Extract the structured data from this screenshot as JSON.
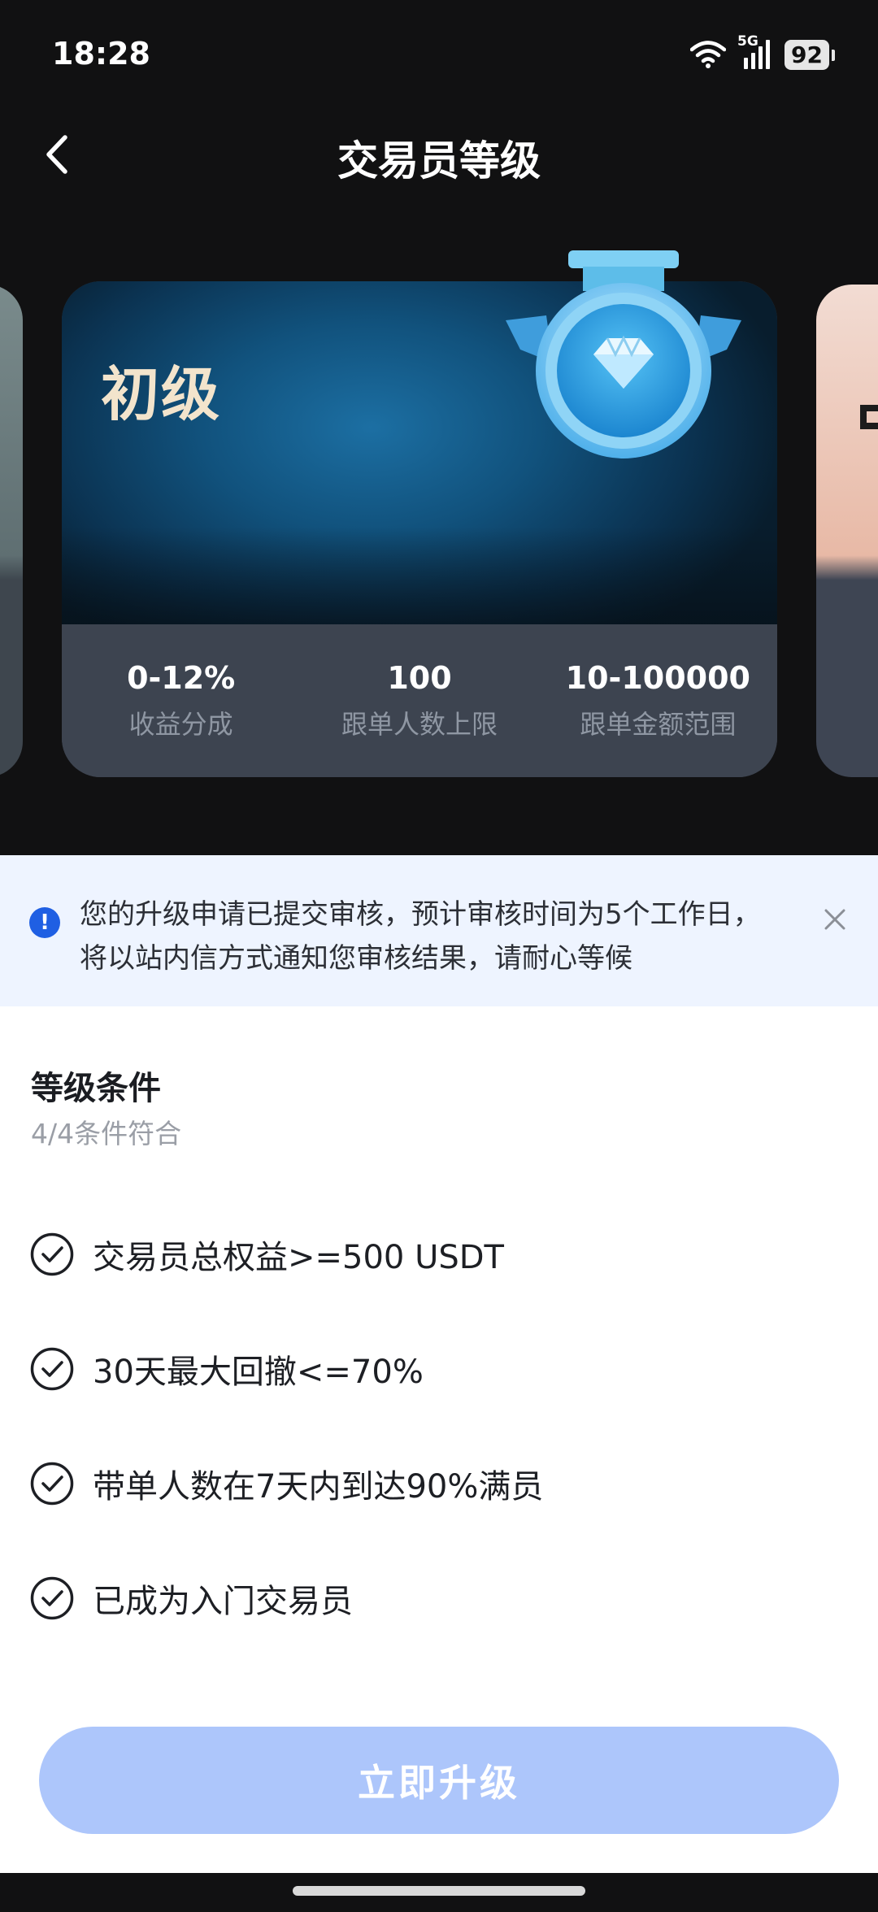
{
  "status_bar": {
    "time": "18:28",
    "network": "5G",
    "battery": "92",
    "icons": [
      "wifi-icon",
      "signal-icon",
      "battery-icon"
    ]
  },
  "nav": {
    "back_icon": "chevron-left-icon",
    "title": "交易员等级"
  },
  "card": {
    "level_name": "初级",
    "medal_icon": "diamond-medal-icon",
    "stats": [
      {
        "value": "0-12%",
        "label": "收益分成"
      },
      {
        "value": "100",
        "label": "跟单人数上限"
      },
      {
        "value": "10-100000",
        "label": "跟单金额范围"
      }
    ]
  },
  "notice": {
    "icon": "exclamation-icon",
    "text": "您的升级申请已提交审核，预计审核时间为5个工作日，将以站内信方式通知您审核结果，请耐心等候",
    "close_icon": "close-icon"
  },
  "conditions": {
    "title": "等级条件",
    "summary": "4/4条件符合",
    "items": [
      {
        "text": "交易员总权益>=500 USDT",
        "met": true
      },
      {
        "text": "30天最大回撤<=70%",
        "met": true
      },
      {
        "text": "带单人数在7天内到达90%满员",
        "met": true
      },
      {
        "text": "已成为入门交易员",
        "met": true
      }
    ]
  },
  "action": {
    "upgrade_label": "立即升级"
  },
  "colors": {
    "accent": "#1f5fe3",
    "button_disabled": "#adc6fb",
    "notice_bg": "#eef4ff",
    "level_text": "#f3e4cc"
  }
}
